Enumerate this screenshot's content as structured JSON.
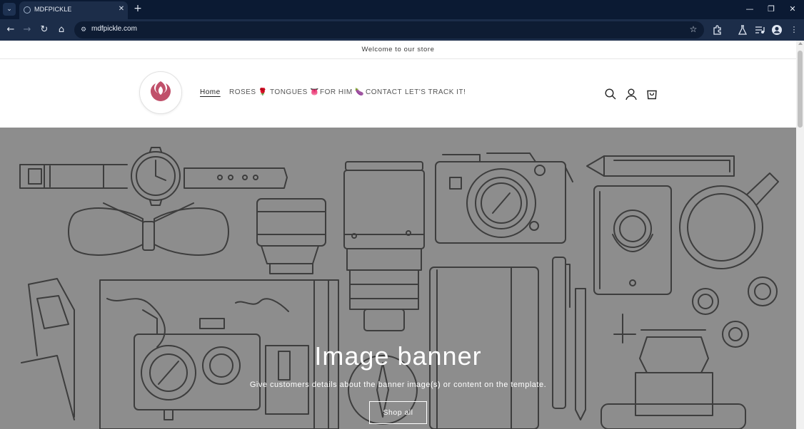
{
  "browser": {
    "tab_title": "MDFPICKLE",
    "tab_close_glyph": "✕",
    "new_tab_glyph": "+",
    "url": "mdfpickle.com",
    "window_controls": {
      "minimize": "—",
      "restore": "❐",
      "close": "✕"
    },
    "nav_glyphs": {
      "back": "←",
      "forward": "→",
      "reload": "↻",
      "home": "⌂"
    },
    "icons": [
      "tab-search-icon",
      "site-info-icon",
      "bookmark-star-icon",
      "extensions-icon",
      "labs-icon",
      "media-control-icon",
      "profile-icon",
      "more-menu-icon"
    ]
  },
  "announcement": {
    "text": "Welcome to our store"
  },
  "header": {
    "logo_icon": "rose-logo-icon",
    "logo_color": "#c0506a",
    "nav": [
      {
        "label": "Home",
        "active": true
      },
      {
        "label": "ROSES 🌹",
        "active": false
      },
      {
        "label": "TONGUES 👅",
        "active": false
      },
      {
        "label": "FOR HIM 🍆",
        "active": false
      },
      {
        "label": "CONTACT",
        "active": false
      },
      {
        "label": "LET'S TRACK IT!",
        "active": false
      }
    ],
    "icons": [
      "search-icon",
      "account-icon",
      "cart-icon"
    ]
  },
  "banner": {
    "title": "Image banner",
    "description": "Give customers details about the banner image(s) or content on the template.",
    "button_label": "Shop all",
    "background_color": "#8d8d8d",
    "illustration_icons": [
      "watch-icon",
      "bow-tie-icon",
      "lens-icon",
      "camera-icon",
      "pencil-icon",
      "passport-icon",
      "frying-pan-icon",
      "sunglasses-icon",
      "map-icon",
      "compass-icon",
      "notebook-icon",
      "pen-icon",
      "buttons-icon",
      "vintage-camera-icon"
    ]
  }
}
